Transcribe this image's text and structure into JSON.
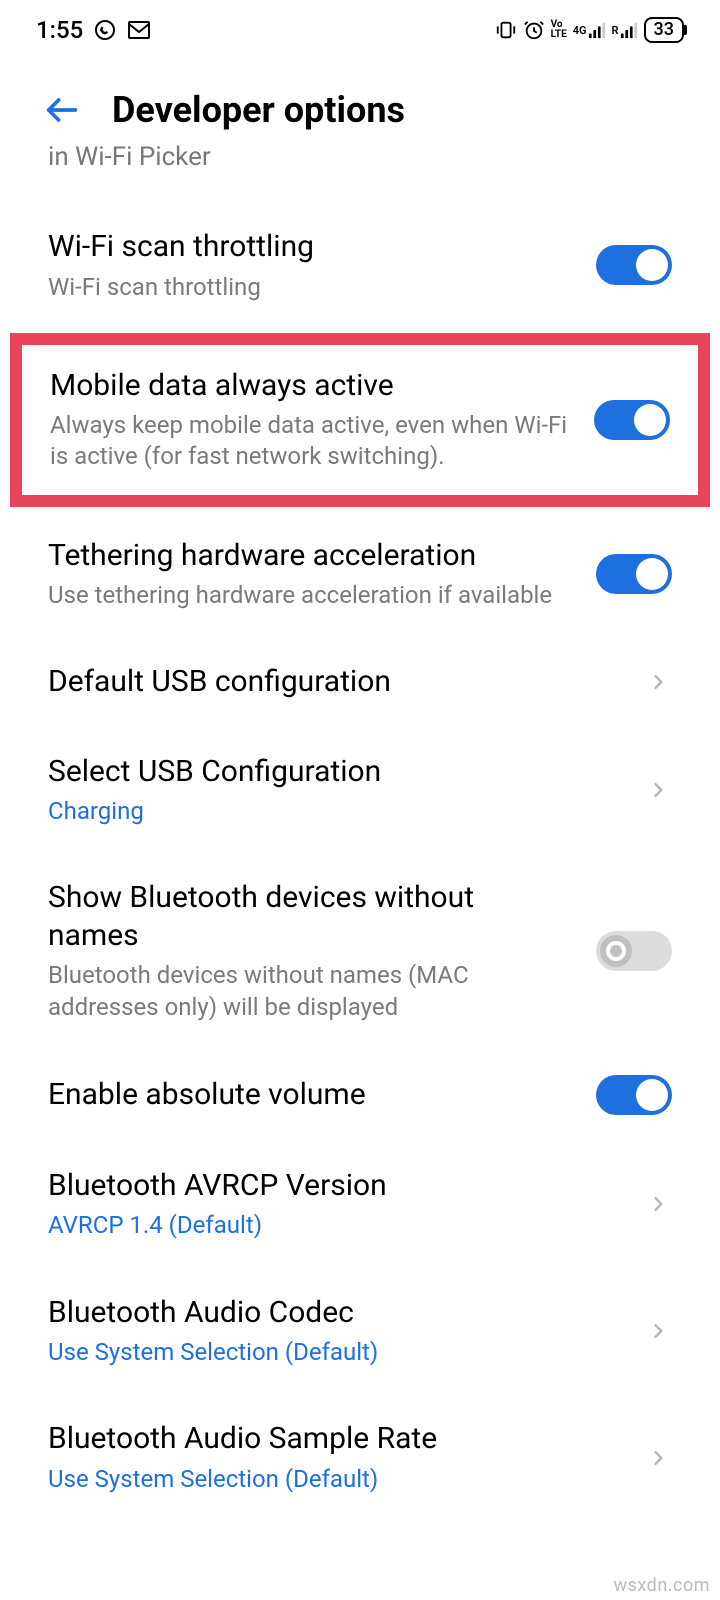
{
  "status": {
    "time": "1:55",
    "battery": "33"
  },
  "header": {
    "title": "Developer options"
  },
  "partial_top": "in Wi-Fi Picker",
  "items": {
    "wifi_scan": {
      "title": "Wi-Fi scan throttling",
      "sub": "Wi-Fi scan throttling"
    },
    "mobile_data": {
      "title": "Mobile data always active",
      "sub": "Always keep mobile data active, even when Wi-Fi is active (for fast network switching)."
    },
    "tethering": {
      "title": "Tethering hardware acceleration",
      "sub": "Use tethering hardware acceleration if available"
    },
    "default_usb": {
      "title": "Default USB configuration"
    },
    "select_usb": {
      "title": "Select USB Configuration",
      "sub": "Charging"
    },
    "bt_noname": {
      "title": "Show Bluetooth devices without names",
      "sub": "Bluetooth devices without names (MAC addresses only) will be displayed"
    },
    "abs_vol": {
      "title": "Enable absolute volume"
    },
    "avrcp": {
      "title": "Bluetooth AVRCP Version",
      "sub": "AVRCP 1.4 (Default)"
    },
    "codec": {
      "title": "Bluetooth Audio Codec",
      "sub": "Use System Selection (Default)"
    },
    "sample": {
      "title": "Bluetooth Audio Sample Rate",
      "sub": "Use System Selection (Default)"
    }
  },
  "watermark": "wsxdn.com"
}
